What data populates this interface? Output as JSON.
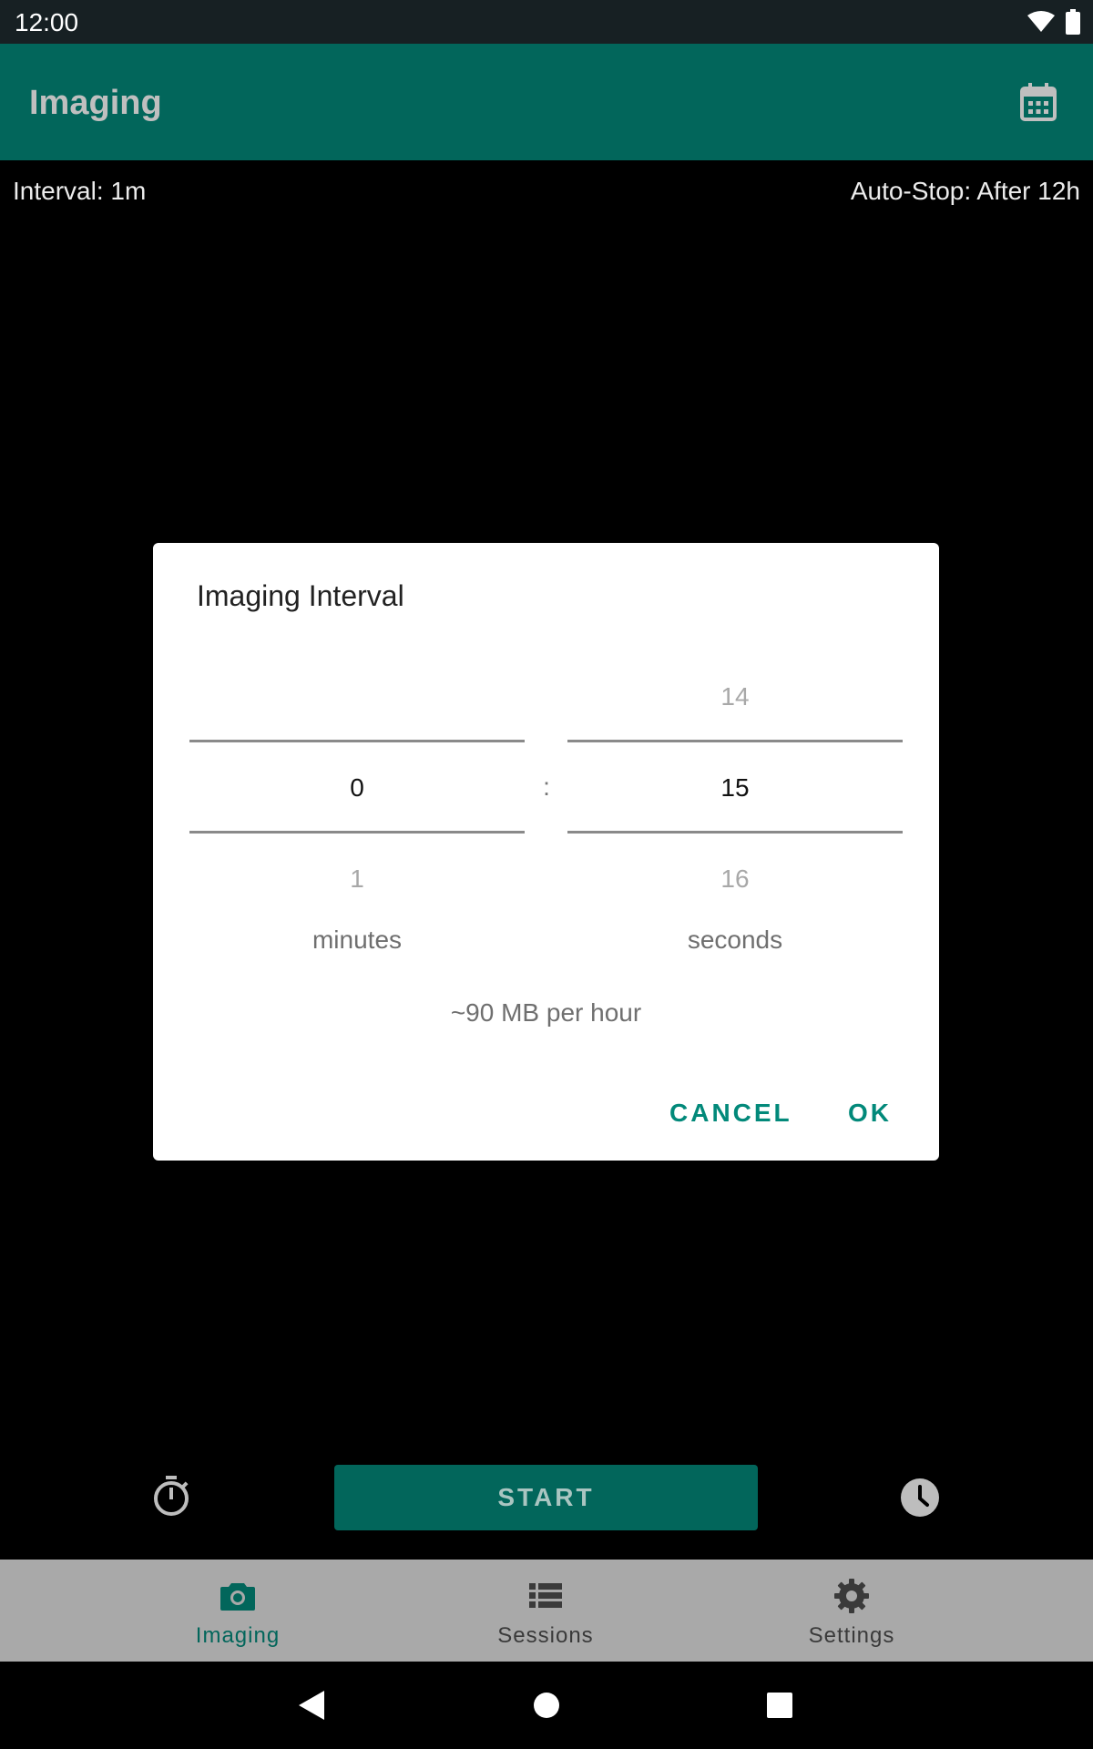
{
  "status_bar": {
    "time": "12:00",
    "icons": [
      "wifi-icon",
      "battery-icon"
    ]
  },
  "app_bar": {
    "title": "Imaging",
    "action_icon": "calendar-icon"
  },
  "info": {
    "interval": "Interval: 1m",
    "auto_stop": "Auto-Stop: After 12h"
  },
  "dialog": {
    "title": "Imaging Interval",
    "minutes": {
      "prev": "",
      "current": "0",
      "next": "1",
      "unit": "minutes"
    },
    "separator": ":",
    "seconds": {
      "prev": "14",
      "current": "15",
      "next": "16",
      "unit": "seconds"
    },
    "size_estimate": "~90 MB per hour",
    "cancel_label": "CANCEL",
    "ok_label": "OK"
  },
  "controls": {
    "start_label": "START",
    "left_icon": "timer-icon",
    "right_icon": "clock-icon"
  },
  "bottom_nav": {
    "items": [
      {
        "label": "Imaging",
        "icon": "camera-icon",
        "active": true
      },
      {
        "label": "Sessions",
        "icon": "list-icon",
        "active": false
      },
      {
        "label": "Settings",
        "icon": "gear-icon",
        "active": false
      }
    ]
  },
  "system_nav": {
    "icons": [
      "back-icon",
      "home-icon",
      "recents-icon"
    ]
  },
  "colors": {
    "primary": "#02665b",
    "accent": "#02897a",
    "status_bar": "#172023",
    "nav_background": "#a9a9a9",
    "nav_active": "#02665b",
    "nav_inactive": "#3a3a3a"
  }
}
